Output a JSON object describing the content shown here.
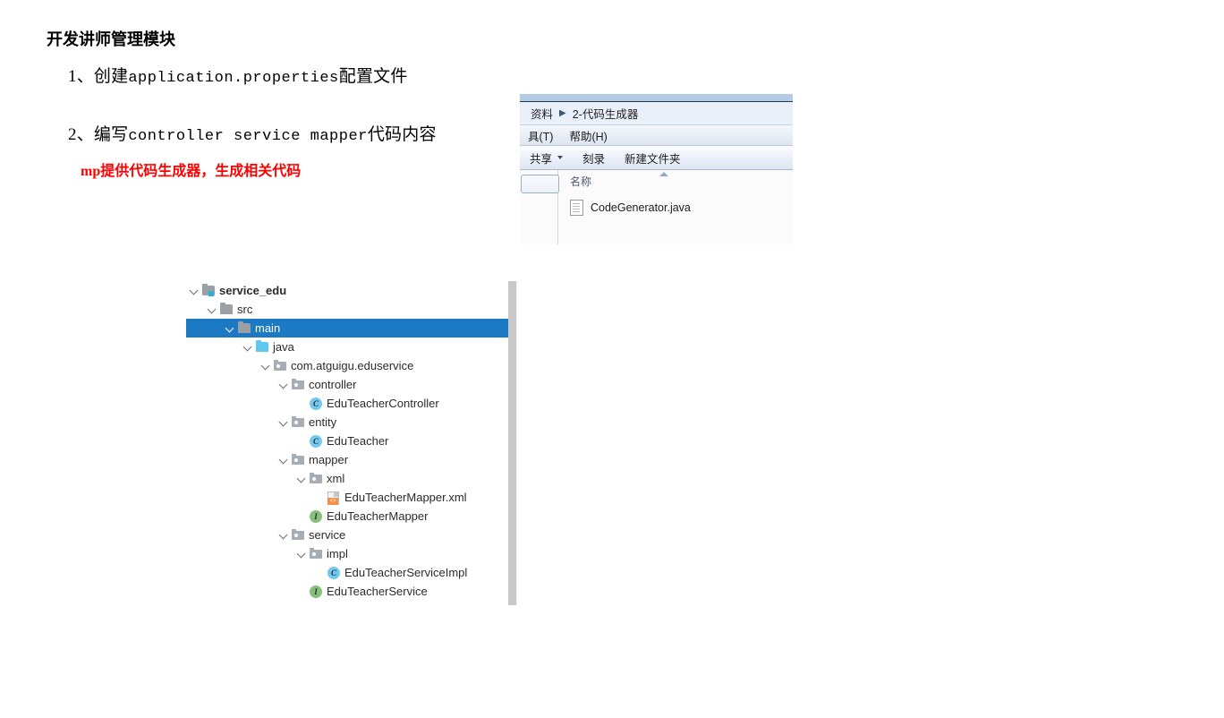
{
  "document": {
    "title": "开发讲师管理模块",
    "steps": [
      {
        "prefix": "1、创建",
        "mono": "application.properties",
        "suffix": "配置文件"
      },
      {
        "prefix": "2、编写",
        "mono": "controller service mapper",
        "suffix": "代码内容"
      }
    ],
    "note": "mp提供代码生成器，生成相关代码"
  },
  "explorer": {
    "breadcrumb": {
      "root": "资料",
      "separator": "▶",
      "current": "2-代码生成器"
    },
    "menubar": [
      "具(T)",
      "帮助(H)"
    ],
    "toolbar": [
      "共享",
      "刻录",
      "新建文件夹"
    ],
    "columns": [
      "名称"
    ],
    "files": [
      {
        "name": "CodeGenerator.java",
        "icon": "java-file-icon"
      }
    ],
    "search_placeholder": ""
  },
  "project_tree": {
    "selected": "main",
    "rows": [
      {
        "label": "service_edu",
        "depth": 0,
        "icon": "module-folder-icon",
        "arrow": "expanded",
        "bold": true,
        "selected": false
      },
      {
        "label": "src",
        "depth": 1,
        "icon": "folder-icon",
        "arrow": "expanded",
        "bold": false,
        "selected": false
      },
      {
        "label": "main",
        "depth": 2,
        "icon": "folder-icon",
        "arrow": "expanded",
        "bold": false,
        "selected": true
      },
      {
        "label": "java",
        "depth": 3,
        "icon": "source-root-icon",
        "arrow": "expanded",
        "bold": false,
        "selected": false
      },
      {
        "label": "com.atguigu.eduservice",
        "depth": 4,
        "icon": "package-icon",
        "arrow": "expanded",
        "bold": false,
        "selected": false
      },
      {
        "label": "controller",
        "depth": 5,
        "icon": "package-icon",
        "arrow": "expanded",
        "bold": false,
        "selected": false
      },
      {
        "label": "EduTeacherController",
        "depth": 6,
        "icon": "java-class-icon",
        "arrow": "none",
        "bold": false,
        "selected": false
      },
      {
        "label": "entity",
        "depth": 5,
        "icon": "package-icon",
        "arrow": "expanded",
        "bold": false,
        "selected": false
      },
      {
        "label": "EduTeacher",
        "depth": 6,
        "icon": "java-class-icon",
        "arrow": "none",
        "bold": false,
        "selected": false
      },
      {
        "label": "mapper",
        "depth": 5,
        "icon": "package-icon",
        "arrow": "expanded",
        "bold": false,
        "selected": false
      },
      {
        "label": "xml",
        "depth": 6,
        "icon": "package-icon",
        "arrow": "expanded",
        "bold": false,
        "selected": false
      },
      {
        "label": "EduTeacherMapper.xml",
        "depth": 7,
        "icon": "xml-file-icon",
        "arrow": "none",
        "bold": false,
        "selected": false
      },
      {
        "label": "EduTeacherMapper",
        "depth": 6,
        "icon": "java-interface-icon",
        "arrow": "none",
        "bold": false,
        "selected": false
      },
      {
        "label": "service",
        "depth": 5,
        "icon": "package-icon",
        "arrow": "expanded",
        "bold": false,
        "selected": false
      },
      {
        "label": "impl",
        "depth": 6,
        "icon": "package-icon",
        "arrow": "expanded",
        "bold": false,
        "selected": false
      },
      {
        "label": "EduTeacherServiceImpl",
        "depth": 7,
        "icon": "java-class-icon",
        "arrow": "none",
        "bold": false,
        "selected": false
      },
      {
        "label": "EduTeacherService",
        "depth": 6,
        "icon": "java-interface-icon",
        "arrow": "none",
        "bold": false,
        "selected": false
      }
    ],
    "icon_letters": {
      "java-class-icon": "C",
      "java-interface-icon": "I",
      "xml-file-icon": "<>"
    }
  },
  "colors": {
    "selection_blue": "#1c7ac4",
    "source_root_blue": "#5fc8ef",
    "package_gray": "#a7adb4",
    "class_icon": "#74c9ef",
    "interface_icon": "#87c07a",
    "xml_badge_orange": "#f58f45",
    "note_red": "#ff0000",
    "scrollbar_thumb": "#c9c9c9"
  }
}
